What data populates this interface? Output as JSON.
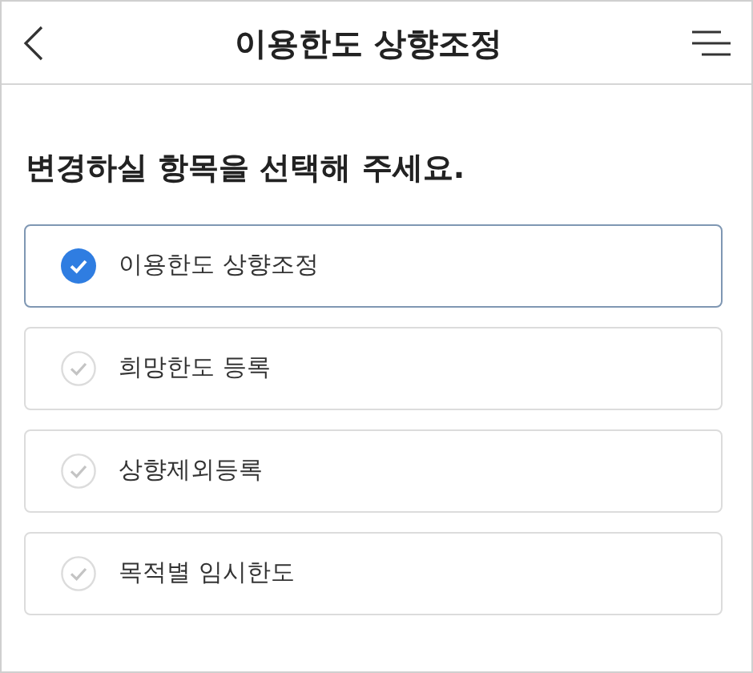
{
  "header": {
    "title": "이용한도 상향조정"
  },
  "prompt": "변경하실 항목을 선택해 주세요.",
  "options": [
    {
      "label": "이용한도 상향조정",
      "selected": true
    },
    {
      "label": "희망한도 등록",
      "selected": false
    },
    {
      "label": "상향제외등록",
      "selected": false
    },
    {
      "label": "목적별 임시한도",
      "selected": false
    }
  ]
}
